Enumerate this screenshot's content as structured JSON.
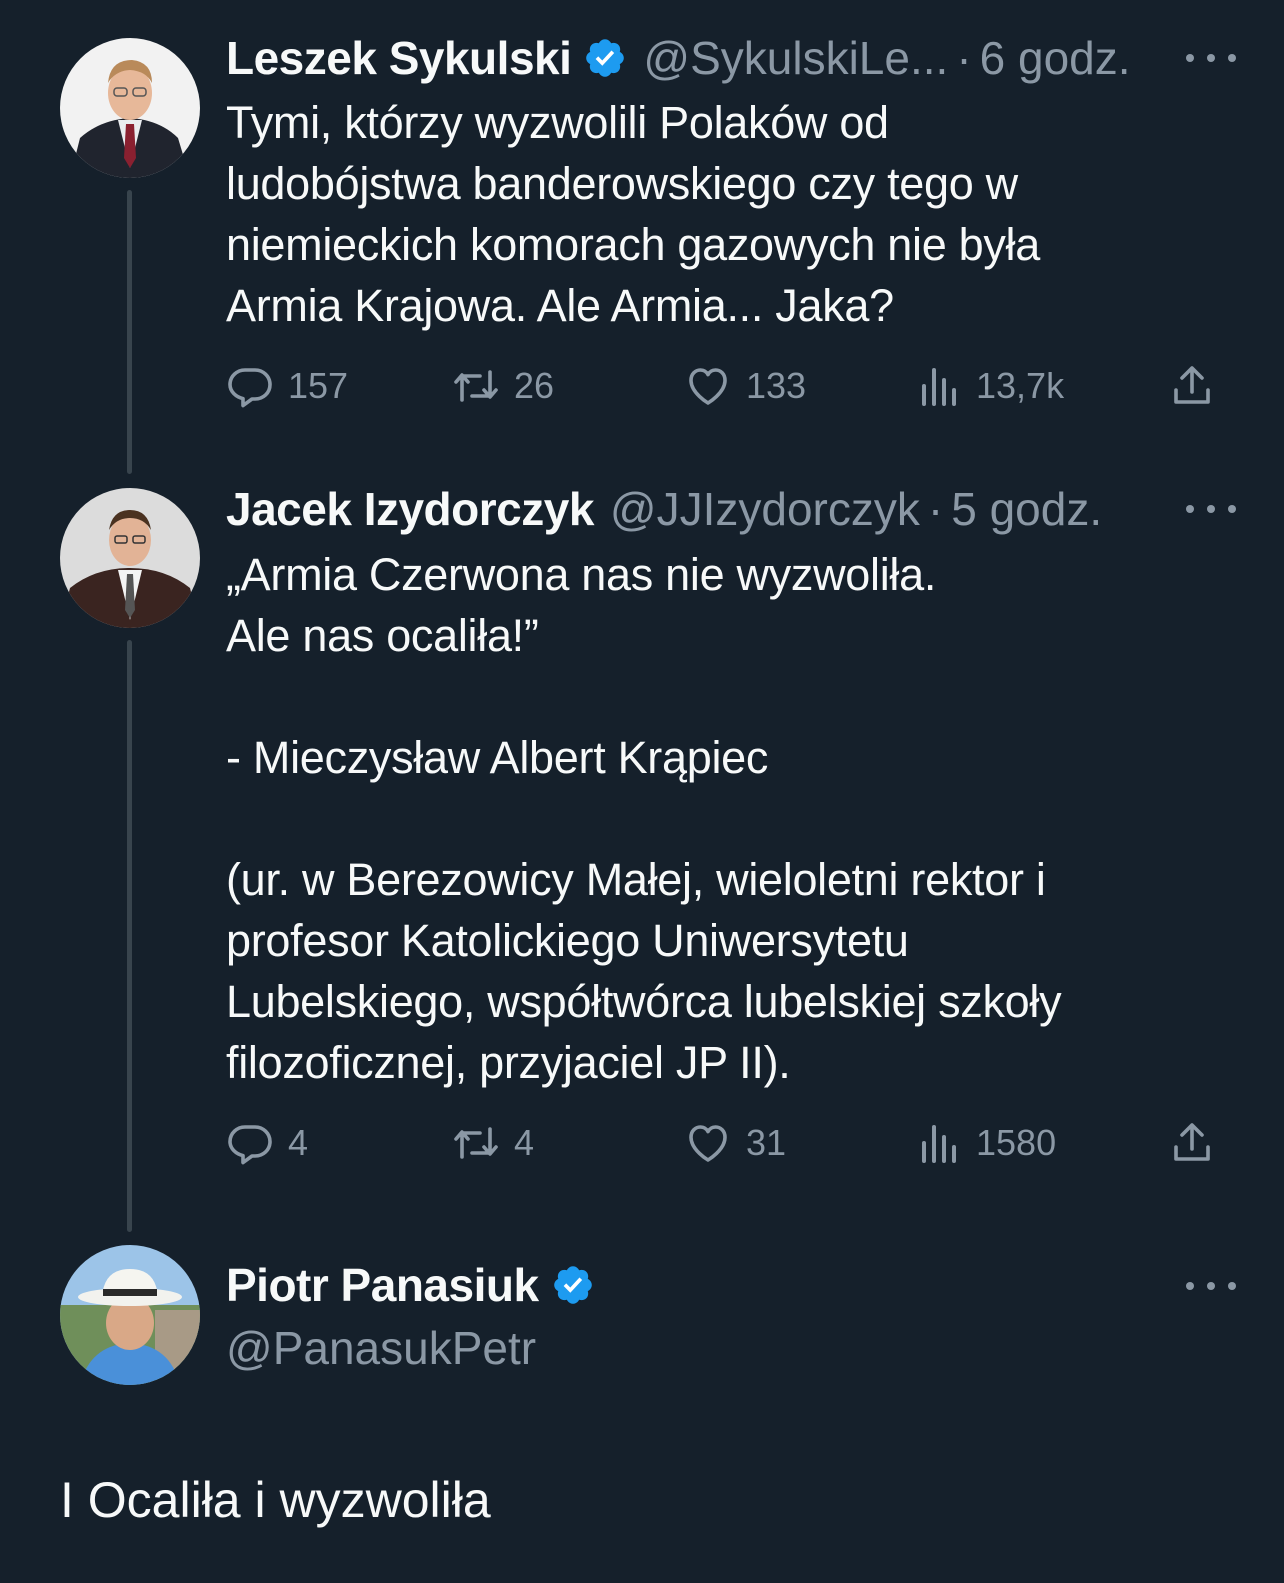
{
  "colors": {
    "background": "#15202b",
    "text_primary": "#f7f9f9",
    "text_secondary": "#8b98a5",
    "verified_badge": "#1d9bf0",
    "thread_line": "#38444d"
  },
  "tweets": [
    {
      "name": "Leszek Sykulski",
      "verified": true,
      "handle": "@SykulskiLe...",
      "separator": "·",
      "time": "6 godz.",
      "text": "Tymi, którzy wyzwolili Polaków od\nludobójstwa banderowskiego czy tego w\nniemieckich komorach gazowych nie była\nArmia Krajowa. Ale Armia... Jaka?",
      "replies": "157",
      "retweets": "26",
      "likes": "133",
      "views": "13,7k",
      "icons": [
        "more-icon",
        "reply-icon",
        "retweet-icon",
        "like-icon",
        "views-icon",
        "share-icon",
        "verified-icon"
      ]
    },
    {
      "name": "Jacek Izydorczyk",
      "verified": false,
      "handle": "@JJIzydorczyk",
      "separator": "·",
      "time": "5 godz.",
      "text": "„Armia Czerwona nas nie wyzwoliła.\nAle nas ocaliła!”\n\n- Mieczysław Albert Krąpiec\n\n(ur. w Berezowicy Małej, wieloletni rektor i\nprofesor Katolickiego Uniwersytetu\nLubelskiego, współtwórca lubelskiej szkoły\nfilozoficznej, przyjaciel JP II).",
      "replies": "4",
      "retweets": "4",
      "likes": "31",
      "views": "1580"
    }
  ],
  "reply": {
    "name": "Piotr Panasiuk",
    "verified": true,
    "handle": "@PanasukPetr",
    "text": "I Ocaliła i wyzwoliła"
  }
}
